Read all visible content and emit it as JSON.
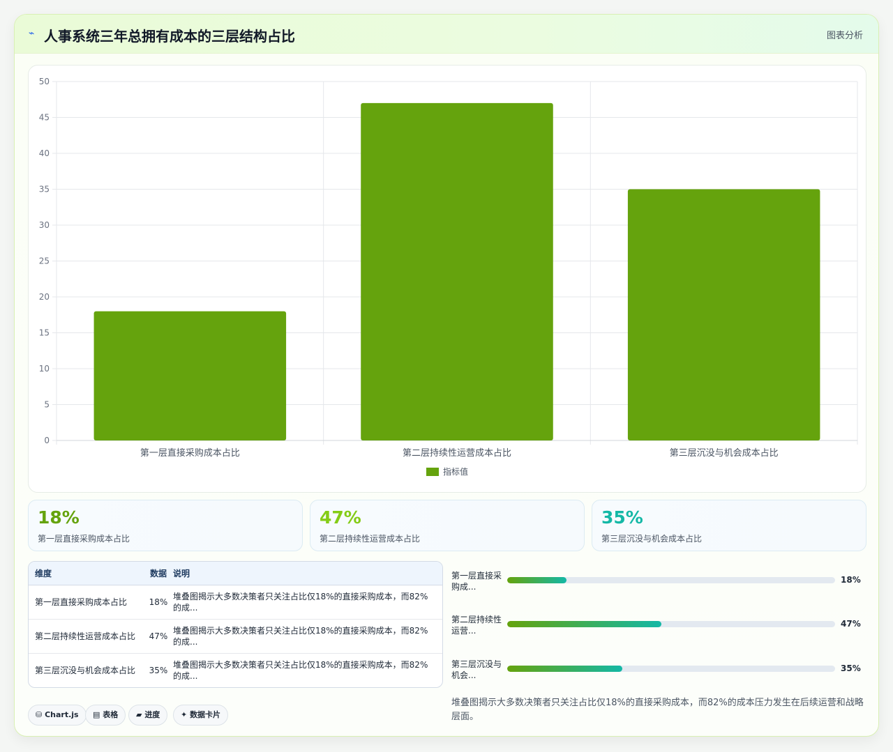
{
  "header": {
    "icon": "chart-line-icon",
    "title": "人事系统三年总拥有成本的三层结构占比",
    "tag": "图表分析"
  },
  "chart_data": {
    "type": "bar",
    "categories": [
      "第一层直接采购成本占比",
      "第二层持续性运营成本占比",
      "第三层沉没与机会成本占比"
    ],
    "series": [
      {
        "name": "指标值",
        "values": [
          18,
          47,
          35
        ],
        "color": "#65a30d"
      }
    ],
    "ylim": [
      0,
      50
    ],
    "yticks": [
      0,
      5,
      10,
      15,
      20,
      25,
      30,
      35,
      40,
      45,
      50
    ],
    "grid": true,
    "legend": "bottom"
  },
  "stats": [
    {
      "value": "18%",
      "label": "第一层直接采购成本占比",
      "color": "#65a30d"
    },
    {
      "value": "47%",
      "label": "第二层持续性运营成本占比",
      "color": "#84cc16"
    },
    {
      "value": "35%",
      "label": "第三层沉没与机会成本占比",
      "color": "#14b8a6"
    }
  ],
  "table": {
    "headers": [
      "维度",
      "数据",
      "说明"
    ],
    "rows": [
      [
        "第一层直接采购成本占比",
        "18%",
        "堆叠图揭示大多数决策者只关注占比仅18%的直接采购成本，而82%的成..."
      ],
      [
        "第二层持续性运营成本占比",
        "47%",
        "堆叠图揭示大多数决策者只关注占比仅18%的直接采购成本，而82%的成..."
      ],
      [
        "第三层沉没与机会成本占比",
        "35%",
        "堆叠图揭示大多数决策者只关注占比仅18%的直接采购成本，而82%的成..."
      ]
    ]
  },
  "chips": [
    {
      "icon": "database-icon",
      "glyph": "⛁",
      "label": "Chart.js"
    },
    {
      "icon": "table-icon",
      "glyph": "▤",
      "label": "表格"
    },
    {
      "icon": "progress-icon",
      "glyph": "▰",
      "label": "进度"
    },
    {
      "icon": "sparkle-icon",
      "glyph": "✦",
      "label": "数据卡片"
    }
  ],
  "progress": [
    {
      "label": "第一层直接采购成...",
      "value": 18,
      "text": "18%"
    },
    {
      "label": "第二层持续性运营...",
      "value": 47,
      "text": "47%"
    },
    {
      "label": "第三层沉没与机会...",
      "value": 35,
      "text": "35%"
    }
  ],
  "note": "堆叠图揭示大多数决策者只关注占比仅18%的直接采购成本，而82%的成本压力发生在后续运营和战略层面。"
}
